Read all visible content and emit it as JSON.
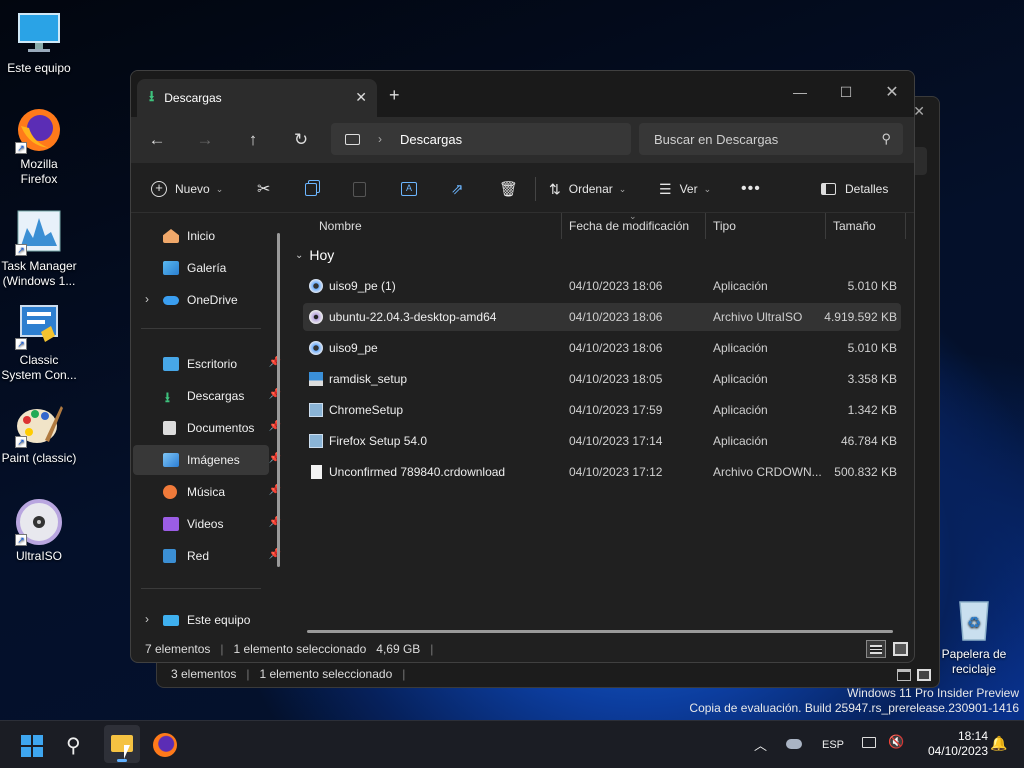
{
  "desktop": {
    "icons": [
      {
        "label": "Este equipo",
        "icon": "monitor-icon"
      },
      {
        "label": "Mozilla Firefox",
        "icon": "firefox-icon"
      },
      {
        "label": "Task Manager (Windows 1...",
        "icon": "task-manager-icon"
      },
      {
        "label": "Classic System Con...",
        "icon": "control-panel-icon"
      },
      {
        "label": "Paint (classic)",
        "icon": "paint-icon"
      },
      {
        "label": "UltraISO",
        "icon": "ultraiso-icon"
      }
    ],
    "recycle_bin": "Papelera de reciclaje",
    "watermark_line1": "Windows 11 Pro Insider Preview",
    "watermark_line2": "Copia de evaluación. Build 25947.rs_prerelease.230901-1416"
  },
  "back_window": {
    "status_items": "3 elementos",
    "status_selected": "1 elemento seleccionado"
  },
  "window": {
    "tab_label": "Descargas",
    "nav": {
      "address": "Descargas",
      "search_placeholder": "Buscar en Descargas"
    },
    "toolbar": {
      "new": "Nuevo",
      "sort": "Ordenar",
      "view": "Ver",
      "details": "Detalles"
    },
    "sidebar": {
      "items": [
        {
          "label": "Inicio"
        },
        {
          "label": "Galería"
        },
        {
          "label": "OneDrive"
        },
        {
          "label": "Escritorio"
        },
        {
          "label": "Descargas"
        },
        {
          "label": "Documentos"
        },
        {
          "label": "Imágenes"
        },
        {
          "label": "Música"
        },
        {
          "label": "Videos"
        },
        {
          "label": "Red"
        },
        {
          "label": "Este equipo"
        }
      ]
    },
    "columns": {
      "name": "Nombre",
      "date": "Fecha de modificación",
      "type": "Tipo",
      "size": "Tamaño"
    },
    "group": "Hoy",
    "files": [
      {
        "name": "uiso9_pe (1)",
        "date": "04/10/2023 18:06",
        "type": "Aplicación",
        "size": "5.010 KB"
      },
      {
        "name": "ubuntu-22.04.3-desktop-amd64",
        "date": "04/10/2023 18:06",
        "type": "Archivo UltraISO",
        "size": "4.919.592 KB"
      },
      {
        "name": "uiso9_pe",
        "date": "04/10/2023 18:06",
        "type": "Aplicación",
        "size": "5.010 KB"
      },
      {
        "name": "ramdisk_setup",
        "date": "04/10/2023 18:05",
        "type": "Aplicación",
        "size": "3.358 KB"
      },
      {
        "name": "ChromeSetup",
        "date": "04/10/2023 17:59",
        "type": "Aplicación",
        "size": "1.342 KB"
      },
      {
        "name": "Firefox Setup 54.0",
        "date": "04/10/2023 17:14",
        "type": "Aplicación",
        "size": "46.784 KB"
      },
      {
        "name": "Unconfirmed 789840.crdownload",
        "date": "04/10/2023 17:12",
        "type": "Archivo CRDOWN...",
        "size": "500.832 KB"
      }
    ],
    "status": {
      "count": "7 elementos",
      "selected": "1 elemento seleccionado",
      "selected_size": "4,69 GB"
    }
  },
  "taskbar": {
    "lang": "ESP",
    "time": "18:14",
    "date": "04/10/2023"
  }
}
